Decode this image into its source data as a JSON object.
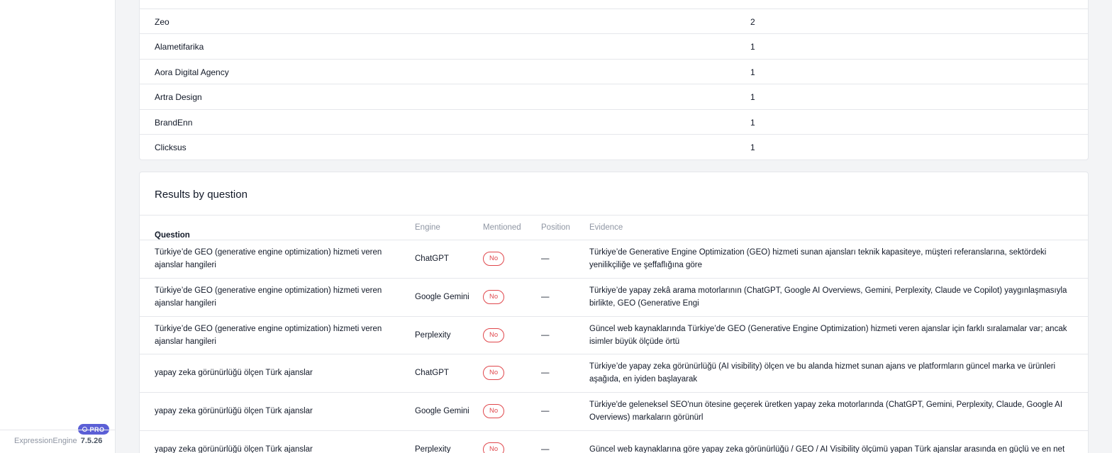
{
  "app": {
    "name": "ExpressionEngine",
    "version": "7.5.26",
    "badge": "PRO"
  },
  "brands": [
    {
      "name": "Zeo",
      "count": "2"
    },
    {
      "name": "Alametifarika",
      "count": "1"
    },
    {
      "name": "Aora Digital Agency",
      "count": "1"
    },
    {
      "name": "Artra Design",
      "count": "1"
    },
    {
      "name": "BrandEnn",
      "count": "1"
    },
    {
      "name": "Clicksus",
      "count": "1"
    }
  ],
  "results": {
    "title": "Results by question",
    "columns": {
      "question": "Question",
      "sort_indicator": "^",
      "engine": "Engine",
      "mentioned": "Mentioned",
      "position": "Position",
      "evidence": "Evidence"
    },
    "rows": [
      {
        "question": "Türkiye’de GEO (generative engine optimization) hizmeti veren ajanslar hangileri",
        "engine": "ChatGPT",
        "mentioned": "No",
        "position": "—",
        "evidence": "Türkiye’de Generative Engine Optimization (GEO) hizmeti sunan ajansları teknik kapasiteye, müşteri referanslarına, sektördeki yenilikçiliğe ve şeffaflığına göre"
      },
      {
        "question": "Türkiye’de GEO (generative engine optimization) hizmeti veren ajanslar hangileri",
        "engine": "Google Gemini",
        "mentioned": "No",
        "position": "—",
        "evidence": "Türkiye’de yapay zekâ arama motorlarının (ChatGPT, Google AI Overviews, Gemini, Perplexity, Claude ve Copilot) yaygınlaşmasıyla birlikte, GEO (Generative Engi"
      },
      {
        "question": "Türkiye’de GEO (generative engine optimization) hizmeti veren ajanslar hangileri",
        "engine": "Perplexity",
        "mentioned": "No",
        "position": "—",
        "evidence": "Güncel web kaynaklarında Türkiye’de GEO (Generative Engine Optimization) hizmeti veren ajanslar için farklı sıralamalar var; ancak isimler büyük ölçüde örtü"
      },
      {
        "question": "yapay zeka görünürlüğü ölçen Türk ajanslar",
        "engine": "ChatGPT",
        "mentioned": "No",
        "position": "—",
        "evidence": "Türkiye’de yapay zeka görünürlüğü (AI visibility) ölçen ve bu alanda hizmet sunan ajans ve platformların güncel marka ve ürünleri aşağıda, en iyiden başlayarak"
      },
      {
        "question": "yapay zeka görünürlüğü ölçen Türk ajanslar",
        "engine": "Google Gemini",
        "mentioned": "No",
        "position": "—",
        "evidence": "Türkiye'de geleneksel SEO'nun ötesine geçerek üretken yapay zeka motorlarında (ChatGPT, Gemini, Perplexity, Claude, Google AI Overviews) markaların görünürl"
      },
      {
        "question": "yapay zeka görünürlüğü ölçen Türk ajanslar",
        "engine": "Perplexity",
        "mentioned": "No",
        "position": "—",
        "evidence": "Güncel web kaynaklarına göre yapay zeka görünürlüğü / GEO / AI Visibility ölçümü yapan Türk ajanslar arasında en güçlü ve en net"
      }
    ]
  }
}
